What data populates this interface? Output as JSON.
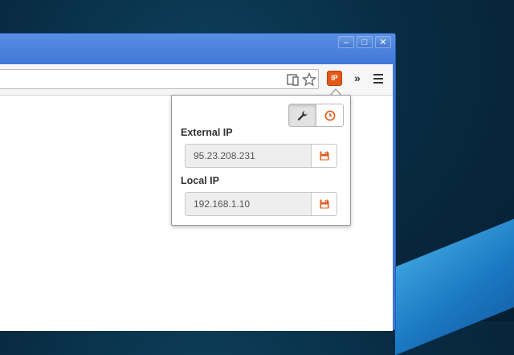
{
  "window": {
    "controls": {
      "minimize": "–",
      "maximize": "□",
      "close": "✕"
    }
  },
  "toolbar": {
    "icons": [
      "device-mode-icon",
      "star-icon"
    ],
    "extension_badge": "IP",
    "overflow_chevron": "»"
  },
  "popup": {
    "external": {
      "label": "External IP",
      "value": "95.23.208.231"
    },
    "local": {
      "label": "Local IP",
      "value": "192.168.1.10"
    },
    "buttons": [
      "settings-wrench",
      "history-clock"
    ],
    "accent_color": "#e4581a"
  }
}
